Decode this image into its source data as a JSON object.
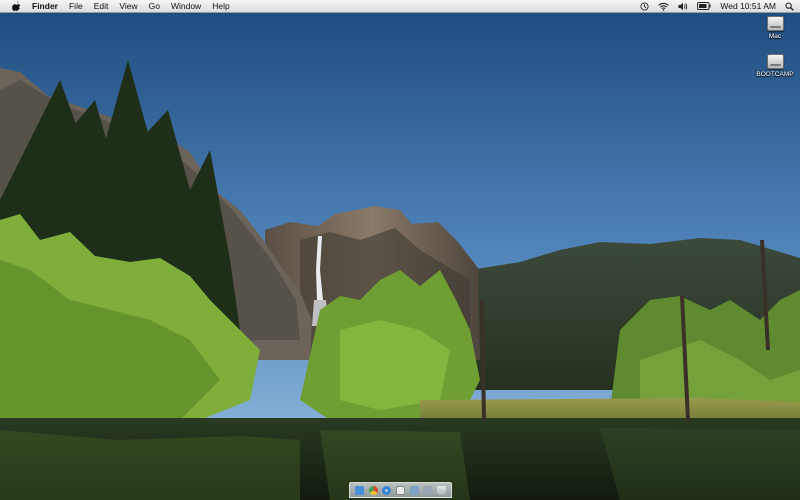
{
  "menubar": {
    "apple_icon": "apple-icon",
    "app_name": "Finder",
    "menus": [
      "File",
      "Edit",
      "View",
      "Go",
      "Window",
      "Help"
    ],
    "status_icons": [
      "time-machine-icon",
      "wifi-icon",
      "volume-icon",
      "battery-icon"
    ],
    "clock": "Wed 10:51 AM",
    "spotlight_icon": "spotlight-search-icon"
  },
  "desktop": {
    "wallpaper": "yosemite-valley-waterfall",
    "drives": [
      {
        "label": "Mac",
        "icon": "hard-drive-icon"
      },
      {
        "label": "BOOTCAMP",
        "icon": "hard-drive-icon"
      }
    ]
  },
  "dock": {
    "items": [
      {
        "name": "finder",
        "color": "#4a8fd9"
      },
      {
        "name": "chrome",
        "color": "#d9462f"
      },
      {
        "name": "safari",
        "color": "#3a86d2"
      },
      {
        "name": "app-4",
        "color": "#e8e8e8"
      },
      {
        "name": "mail",
        "color": "#7ea0c4"
      },
      {
        "name": "app-6",
        "color": "#9aa6b3"
      },
      {
        "name": "trash",
        "color": "#c8ced4"
      }
    ]
  },
  "colors": {
    "sky_top": "#1d4a7c",
    "sky_bottom": "#8fb8de",
    "foliage": "#7fae3a",
    "water": "#1c2414"
  }
}
